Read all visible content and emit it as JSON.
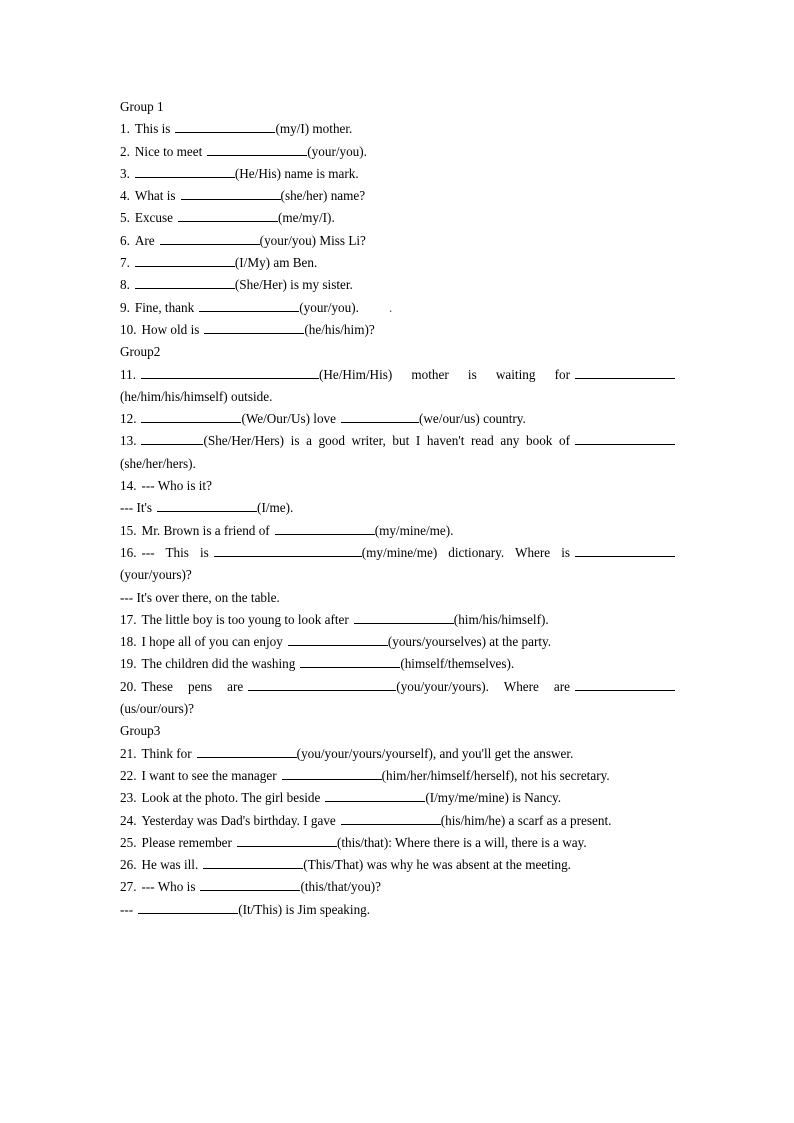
{
  "document": {
    "background_color": "#ffffff",
    "text_color": "#000000",
    "groups": [
      {
        "label": "Group 1",
        "items": [
          {
            "number": "1.",
            "pre": "This is",
            "blank": "b-md",
            "post": "(my/I) mother."
          },
          {
            "number": "2.",
            "pre": "Nice to meet",
            "blank": "b-md",
            "post": "(your/you)."
          },
          {
            "number": "3.",
            "pre": "",
            "blank": "b-md",
            "post": "(He/His) name is mark."
          },
          {
            "number": "4.",
            "pre": "What is",
            "blank": "b-md",
            "post": "(she/her) name?"
          },
          {
            "number": "5.",
            "pre": "Excuse",
            "blank": "b-md",
            "post": "(me/my/I)."
          },
          {
            "number": "6.",
            "pre": "Are",
            "blank": "b-md",
            "post": "(your/you) Miss Li?"
          },
          {
            "number": "7.",
            "pre": "",
            "blank": "b-md",
            "post": "(I/My) am Ben."
          },
          {
            "number": "8.",
            "pre": "",
            "blank": "b-md",
            "post": "(She/Her) is my sister."
          },
          {
            "number": "9.",
            "pre": "Fine, thank",
            "blank": "b-md",
            "post": "(your/you).",
            "trailing_mark": "."
          },
          {
            "number": "10.",
            "pre": "How old is",
            "blank": "b-md",
            "post": "(he/his/him)?"
          }
        ]
      },
      {
        "label": "Group2",
        "items": [
          {
            "number": "11.",
            "pre": "",
            "blank": "b-xxl",
            "post": "(He/Him/His) mother is waiting for",
            "blank2": "b-md",
            "post2": "(he/him/his/himself) outside."
          },
          {
            "number": "12.",
            "pre": "",
            "blank": "b-md",
            "post": "(We/Our/Us) love",
            "blank2": "b-sm",
            "post2": "(we/our/us) country."
          },
          {
            "number": "13.",
            "pre": "",
            "blank": "b-xs",
            "post": "(She/Her/Hers) is a good writer, but I haven't read any book of",
            "blank2": "b-md",
            "post2": "(she/her/hers)."
          },
          {
            "number": "14.",
            "pre": "--- Who is it?",
            "blank": null,
            "post": ""
          },
          {
            "number": "",
            "pre": "--- It's",
            "blank": "b-md",
            "post": "(I/me)."
          },
          {
            "number": "15.",
            "pre": "Mr. Brown is a friend of",
            "blank": "b-md",
            "post": "(my/mine/me)."
          },
          {
            "number": "16.",
            "pre": "--- This is",
            "blank": "b-xl",
            "post": "(my/mine/me) dictionary. Where is",
            "blank2": "b-md",
            "post2": "(your/yours)?"
          },
          {
            "number": "",
            "pre": "--- It's over there, on the table.",
            "blank": null,
            "post": ""
          },
          {
            "number": "17.",
            "pre": "The little boy is too young to look after",
            "blank": "b-md",
            "post": "(him/his/himself)."
          },
          {
            "number": "18.",
            "pre": "I hope all of you can enjoy",
            "blank": "b-md",
            "post": "(yours/yourselves) at the party."
          },
          {
            "number": "19.",
            "pre": "The children did the washing",
            "blank": "b-md",
            "post": "(himself/themselves)."
          },
          {
            "number": "20.",
            "pre": "These pens are",
            "blank": "b-xl",
            "post": "(you/your/yours). Where are",
            "blank2": "b-md",
            "post2": "(us/our/ours)?"
          }
        ]
      },
      {
        "label": "Group3",
        "items": [
          {
            "number": "21.",
            "pre": "Think for",
            "blank": "b-md",
            "post": "(you/your/yours/yourself), and you'll get the answer."
          },
          {
            "number": "22.",
            "pre": "I want to see the manager",
            "blank": "b-md",
            "post": "(him/her/himself/herself), not his secretary."
          },
          {
            "number": "23.",
            "pre": "Look at the photo. The girl beside",
            "blank": "b-md",
            "post": "(I/my/me/mine) is Nancy."
          },
          {
            "number": "24.",
            "pre": "Yesterday was Dad's birthday. I gave",
            "blank": "b-md",
            "post": "(his/him/he) a scarf as a present."
          },
          {
            "number": "25.",
            "pre": "Please remember",
            "blank": "b-md",
            "post": "(this/that): Where there is a will, there is a way."
          },
          {
            "number": "26.",
            "pre": "He was ill.",
            "blank": "b-md",
            "post": "(This/That) was why he was absent at the meeting."
          },
          {
            "number": "27.",
            "pre": "--- Who is",
            "blank": "b-md",
            "post": "(this/that/you)?"
          },
          {
            "number": "",
            "pre": "---",
            "blank": "b-md",
            "post": "(It/This) is Jim speaking."
          }
        ]
      }
    ]
  }
}
